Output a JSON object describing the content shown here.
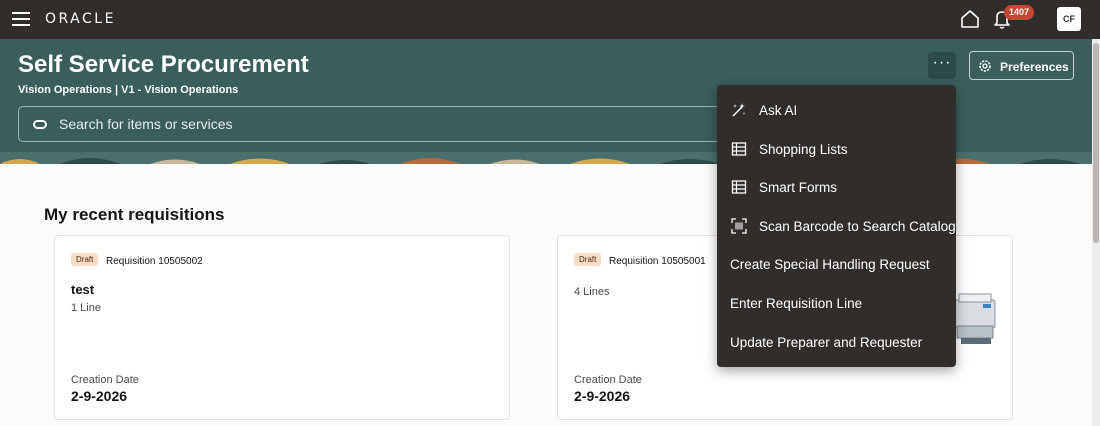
{
  "topbar": {
    "logo": "ORACLE",
    "notification_count": "1407",
    "user_initials": "CF",
    "icons": [
      "menu-icon",
      "home-icon",
      "bell-icon"
    ]
  },
  "header": {
    "title": "Self Service Procurement",
    "subtitle": "Vision Operations | V1 - Vision Operations",
    "search_placeholder": "Search for items or services",
    "more_label": "···",
    "preferences_label": "Preferences"
  },
  "main": {
    "section_title": "My recent requisitions",
    "cards": [
      {
        "status": "Draft",
        "requisition": "Requisition 10505002",
        "name": "test",
        "lines": "1 Line",
        "date_label": "Creation Date",
        "date": "2-9-2026"
      },
      {
        "status": "Draft",
        "requisition": "Requisition 10505001",
        "name": "",
        "lines": "4 Lines",
        "date_label": "Creation Date",
        "date": "2-9-2026"
      }
    ]
  },
  "menu": {
    "items": [
      {
        "label": "Ask AI",
        "icon": "magic-wand-icon"
      },
      {
        "label": "Shopping Lists",
        "icon": "table-icon"
      },
      {
        "label": "Smart Forms",
        "icon": "table-icon"
      },
      {
        "label": "Scan Barcode to Search Catalog",
        "icon": "barcode-scan-icon"
      },
      {
        "label": "Create Special Handling Request",
        "icon": ""
      },
      {
        "label": "Enter Requisition Line",
        "icon": ""
      },
      {
        "label": "Update Preparer and Requester",
        "icon": ""
      }
    ]
  },
  "colors": {
    "topbar": "#312d2a",
    "header": "#3a5e5c",
    "badge": "#c74634",
    "draft_badge": "#fbdcc4"
  }
}
